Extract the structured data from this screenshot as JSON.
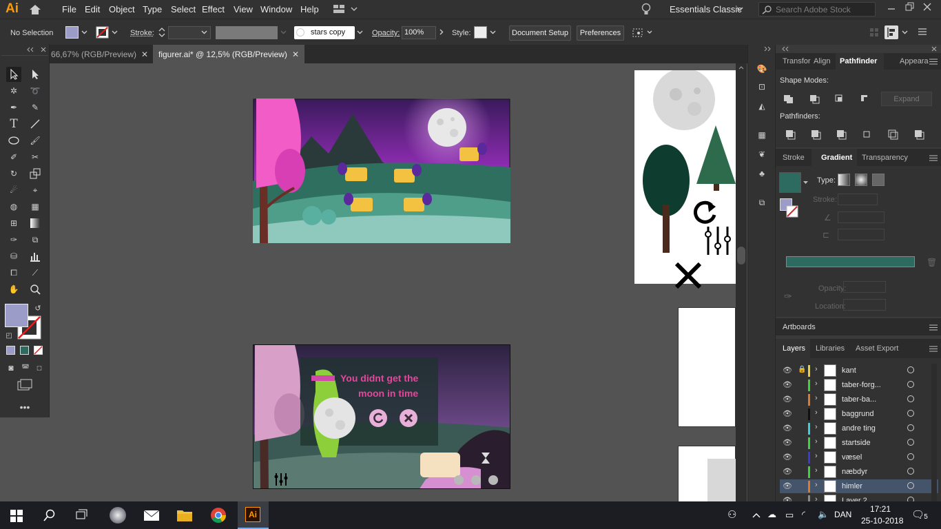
{
  "app": {
    "logo": "Ai"
  },
  "menu": [
    "File",
    "Edit",
    "Object",
    "Type",
    "Select",
    "Effect",
    "View",
    "Window",
    "Help"
  ],
  "workspace": "Essentials Classic",
  "search": {
    "placeholder": "Search Adobe Stock"
  },
  "control": {
    "selection": "No Selection",
    "stroke_label": "Stroke:",
    "brush": "stars copy",
    "opacity_label": "Opacity:",
    "opacity": "100%",
    "style_label": "Style:",
    "doc_setup": "Document Setup",
    "preferences": "Preferences"
  },
  "tabs": [
    {
      "label": "66,67% (RGB/Preview)",
      "active": false
    },
    {
      "label": "figurer.ai* @ 12,5% (RGB/Preview)",
      "active": true
    }
  ],
  "game": {
    "lose_line1": "You didnt get the",
    "lose_line2": "moon in time"
  },
  "panel_tabs": {
    "top": [
      "Transfor",
      "Align",
      "Pathfinder",
      "Appeara"
    ],
    "mid": [
      "Stroke",
      "Gradient",
      "Transparency"
    ],
    "bottom": [
      "Layers",
      "Libraries",
      "Asset Export"
    ]
  },
  "pathfinder": {
    "shape_modes": "Shape Modes:",
    "expand": "Expand",
    "pathfinders": "Pathfinders:"
  },
  "gradient": {
    "type": "Type:",
    "stroke": "Stroke:",
    "opacity": "Opacity:",
    "location": "Location:"
  },
  "artboards": "Artboards",
  "layers": [
    {
      "name": "kant",
      "color": "#e6d33a",
      "locked": true
    },
    {
      "name": "taber-forg...",
      "color": "#3bd43b"
    },
    {
      "name": "taber-ba...",
      "color": "#e07a2a"
    },
    {
      "name": "baggrund",
      "color": "#111111"
    },
    {
      "name": "andre ting",
      "color": "#3ad0e0"
    },
    {
      "name": "startside",
      "color": "#3bd43b"
    },
    {
      "name": "væsel",
      "color": "#3a3ad4"
    },
    {
      "name": "næbdyr",
      "color": "#3bd43b"
    },
    {
      "name": "himler",
      "color": "#e07a2a",
      "selected": true
    },
    {
      "name": "Layer 2",
      "color": "#8a8a8a"
    }
  ],
  "tray": {
    "lang": "DAN",
    "time": "17:21",
    "date": "25-10-2018",
    "notifications": "5"
  },
  "colors": {
    "fill": "#9c9cc8",
    "accent": "#31a8ff"
  }
}
